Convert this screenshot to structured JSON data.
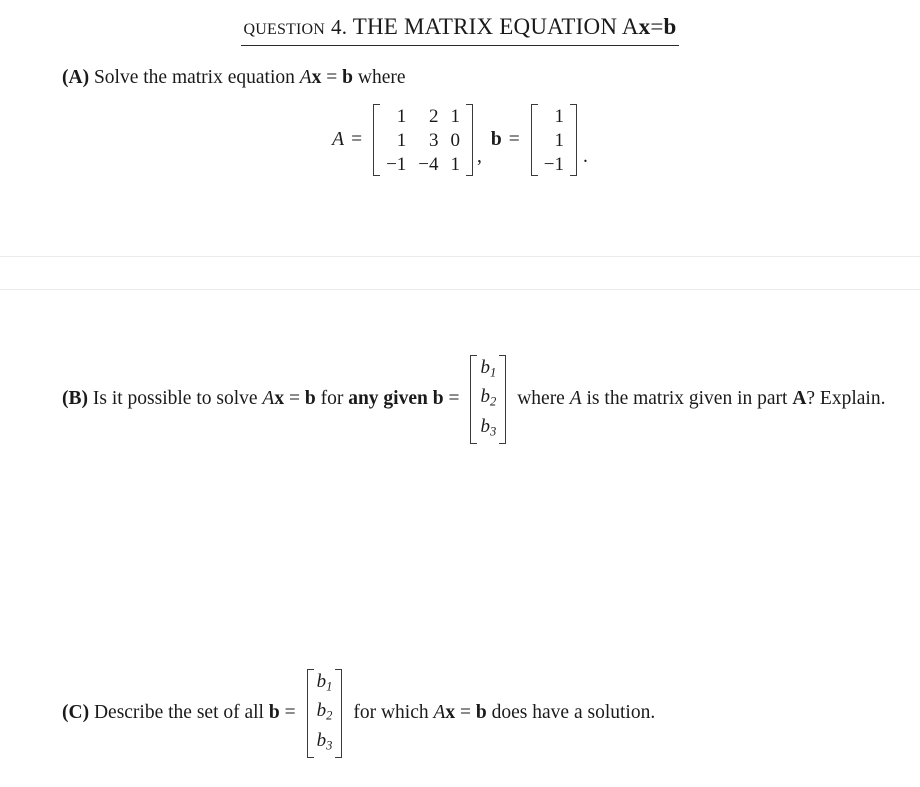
{
  "document": {
    "title": {
      "question_word": "Question",
      "number": "4.",
      "heading": "THE MATRIX EQUATION",
      "equation_A": "A",
      "equation_x": "x",
      "equation_eq": "=",
      "equation_b": "b"
    },
    "parts": [
      {
        "label": "(A)",
        "text_before": "Solve the matrix equation",
        "math_A": "A",
        "math_x": "x",
        "math_eq": "=",
        "math_b": "b",
        "text_after": "where"
      },
      {
        "label": "(B)",
        "text_1": "Is it possible to solve",
        "math_A": "A",
        "math_x": "x",
        "math_eq": "=",
        "math_b": "b",
        "text_2": "for",
        "bold_phrase": "any given b",
        "eq_sign": "=",
        "text_3": "where",
        "math_A2": "A",
        "text_4": "is the matrix given in part",
        "bold_part_ref": "A",
        "text_5": "? Explain."
      },
      {
        "label": "(C)",
        "text_1": "Describe the set of all",
        "math_b": "b",
        "eq_sign": "=",
        "text_2": "for which",
        "math_A": "A",
        "math_x": "x",
        "math_eq": "=",
        "math_b2": "b",
        "text_3": "does have a solution."
      }
    ],
    "display_equation": {
      "A_label": "A",
      "eq1": "=",
      "matrix_A": [
        [
          "1",
          "2",
          "1"
        ],
        [
          "1",
          "3",
          "0"
        ],
        [
          "−1",
          "−4",
          "1"
        ]
      ],
      "separator": ",",
      "b_label": "b",
      "eq2": "=",
      "vector_b": [
        [
          "1"
        ],
        [
          "1"
        ],
        [
          "−1"
        ]
      ],
      "terminator": "."
    },
    "generic_vector_b": {
      "rows": [
        "b",
        "b",
        "b"
      ],
      "subscripts": [
        "1",
        "2",
        "3"
      ]
    },
    "colors": {
      "text": "#1a1a1a",
      "rule": "#e9eaec",
      "bracket": "#3a3a3a",
      "background": "#ffffff"
    }
  }
}
